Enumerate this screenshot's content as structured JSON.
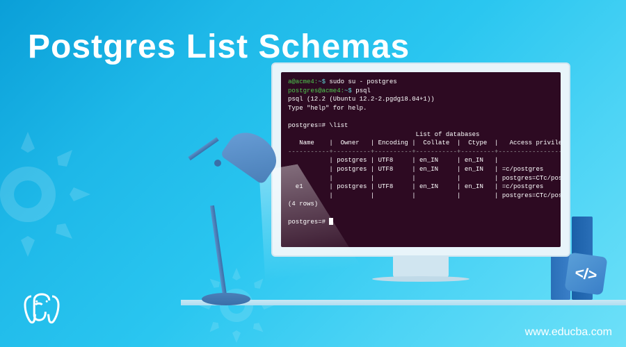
{
  "header": {
    "title": "Postgres List Schemas"
  },
  "footer": {
    "watermark": "www.educba.com"
  },
  "code_badge": {
    "symbol": "</>"
  },
  "terminal": {
    "prompt1_user": "a@acme4:",
    "prompt1_path": "~$ ",
    "cmd1": "sudo su - postgres",
    "prompt2_user": "postgres@acme4:",
    "prompt2_path": "~$ ",
    "cmd2": "psql",
    "version": "psql (12.2 (Ubuntu 12.2-2.pgdg18.04+1))",
    "help_hint": "Type \"help\" for help.",
    "prompt3": "postgres=# ",
    "cmd3": "\\list",
    "table_title": "                                  List of databases",
    "table_header": "   Name    |  Owner   | Encoding |  Collate  |  Ctype  |   Access privileges",
    "table_divider": "-----------+----------+----------+-----------+---------+-----------------------",
    "row1": "           | postgres | UTF8     | en_IN     | en_IN   |",
    "row2": "           | postgres | UTF8     | en_IN     | en_IN   | =c/postgres          +",
    "row3": "           |          |          |           |         | postgres=CTc/postgres+",
    "row4": "  e1       | postgres | UTF8     | en_IN     | en_IN   | =c/postgres          +",
    "row5": "           |          |          |           |         | postgres=CTc/postgres",
    "rows_count": "(4 rows)",
    "prompt4": "postgres=# "
  }
}
